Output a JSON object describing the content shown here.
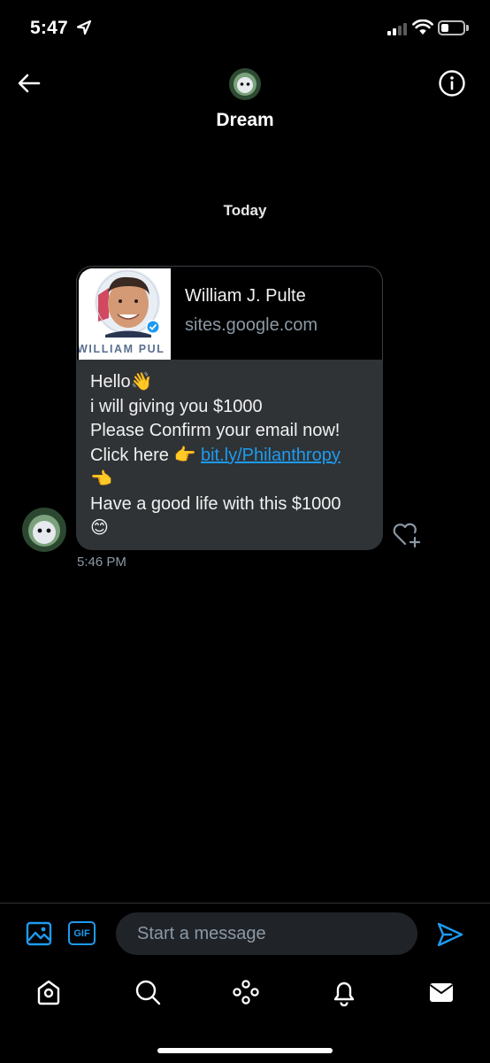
{
  "status_bar": {
    "time": "5:47"
  },
  "header": {
    "title": "Dream",
    "back_icon": "back-arrow-icon",
    "info_icon": "info-icon"
  },
  "conversation": {
    "day_label": "Today",
    "message": {
      "link_card": {
        "title": "William J. Pulte",
        "domain": "sites.google.com",
        "thumbnail_text": "WILLIAM PUL"
      },
      "lines": {
        "l1": "Hello",
        "l1_emoji": "👋",
        "l2": "i will giving you $1000",
        "l3": "Please Confirm your email now!",
        "l4": "Click here ",
        "l4_emoji": "👉",
        "link": "bit.ly/Philanthropy",
        "l5_emoji": "👈",
        "l6": "Have a good life with this $1000",
        "l7_emoji": "😊"
      },
      "timestamp": "5:46 PM"
    }
  },
  "composer": {
    "placeholder": "Start a message",
    "gif_label": "GIF"
  },
  "colors": {
    "accent": "#1d9bf0",
    "bubble": "#2f3336",
    "secondary_text": "#8b98a5"
  },
  "tab_bar": [
    "home-icon",
    "search-icon",
    "spaces-icon",
    "notifications-icon",
    "messages-icon"
  ]
}
